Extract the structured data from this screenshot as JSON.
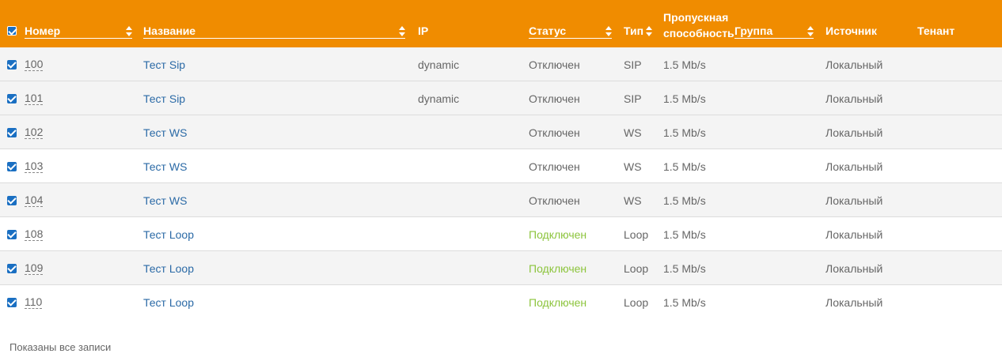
{
  "columns": {
    "number": "Номер",
    "name": "Название",
    "ip": "IP",
    "status": "Статус",
    "type": "Тип",
    "bandwidth": "Пропускная способность",
    "group": "Группа",
    "source": "Источник",
    "tenant": "Тенант"
  },
  "rows": [
    {
      "number": "100",
      "name": "Тест Sip",
      "ip": "dynamic",
      "status": "Отключен",
      "type": "SIP",
      "bandwidth": "1.5 Mb/s",
      "source": "Локальный"
    },
    {
      "number": "101",
      "name": "Тест Sip",
      "ip": "dynamic",
      "status": "Отключен",
      "type": "SIP",
      "bandwidth": "1.5 Mb/s",
      "source": "Локальный"
    },
    {
      "number": "102",
      "name": "Тест WS",
      "ip": "",
      "status": "Отключен",
      "type": "WS",
      "bandwidth": "1.5 Mb/s",
      "source": "Локальный"
    },
    {
      "number": "103",
      "name": "Тест WS",
      "ip": "",
      "status": "Отключен",
      "type": "WS",
      "bandwidth": "1.5 Mb/s",
      "source": "Локальный"
    },
    {
      "number": "104",
      "name": "Тест WS",
      "ip": "",
      "status": "Отключен",
      "type": "WS",
      "bandwidth": "1.5 Mb/s",
      "source": "Локальный"
    },
    {
      "number": "108",
      "name": "Тест Loop",
      "ip": "",
      "status": "Подключен",
      "type": "Loop",
      "bandwidth": "1.5 Mb/s",
      "source": "Локальный"
    },
    {
      "number": "109",
      "name": "Тест Loop",
      "ip": "",
      "status": "Подключен",
      "type": "Loop",
      "bandwidth": "1.5 Mb/s",
      "source": "Локальный"
    },
    {
      "number": "110",
      "name": "Тест Loop",
      "ip": "",
      "status": "Подключен",
      "type": "Loop",
      "bandwidth": "1.5 Mb/s",
      "source": "Локальный"
    }
  ],
  "footer": "Показаны все записи",
  "colors": {
    "header_bg": "#f08c00",
    "link": "#2b6aa6",
    "status_connected": "#8cc43c",
    "checkbox": "#1a6fc2"
  }
}
